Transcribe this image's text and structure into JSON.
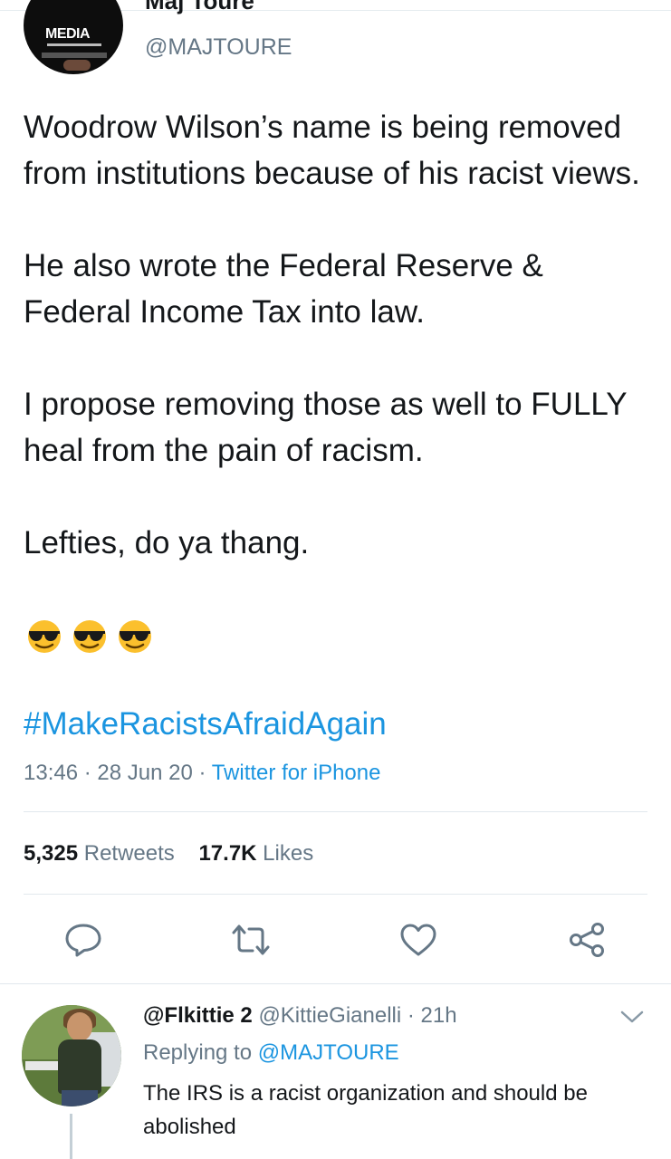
{
  "tweet": {
    "author": {
      "display_name_partial": "Maj Toure",
      "handle": "@MAJTOURE",
      "avatar_text": "MEDIA",
      "avatar_icon": "avatar-photo"
    },
    "text": "Woodrow Wilson’s name is being removed from institutions because of his racist views.\n\nHe also wrote the Federal Reserve & Federal Income Tax into law.\n\nI propose removing those as well to FULLY heal from the pain of racism.\n\nLefties, do ya thang.",
    "emojis": [
      "😎",
      "😎",
      "😎"
    ],
    "hashtag": "#MakeRacistsAfraidAgain",
    "time": "13:46",
    "date": "28 Jun 20",
    "source": "Twitter for iPhone",
    "separator": " · ",
    "stats": {
      "retweets_count": "5,325",
      "retweets_label": "Retweets",
      "likes_count": "17.7K",
      "likes_label": "Likes"
    },
    "actions": [
      "reply-icon",
      "retweet-icon",
      "like-icon",
      "share-icon"
    ]
  },
  "reply": {
    "display_name": "@Flkittie 2",
    "handle": "@KittieGianelli",
    "age": "21h",
    "separator": " · ",
    "replying_prefix": "Replying to ",
    "replying_target": "@MAJTOURE",
    "text": "The IRS  is a racist organization and should be abolished"
  },
  "colors": {
    "text": "#14171a",
    "secondary": "#657786",
    "link": "#1b95e0",
    "divider": "#e1e8ed"
  }
}
